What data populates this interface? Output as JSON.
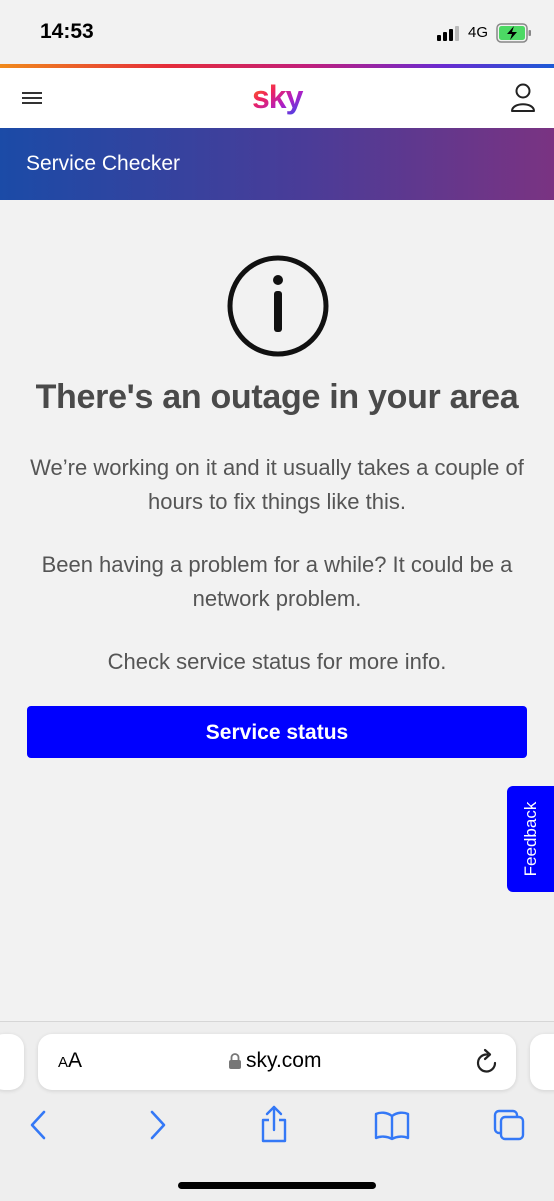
{
  "status_bar": {
    "time": "14:53",
    "network": "4G",
    "icons": [
      "signal-icon",
      "battery-charging-icon"
    ]
  },
  "header": {
    "logo_text": "sky",
    "icons": [
      "hamburger-menu-icon",
      "account-icon"
    ]
  },
  "banner": {
    "title": "Service Checker"
  },
  "main": {
    "icon": "info-circle-icon",
    "heading": "There's an outage in your area",
    "paragraph_1": "We’re working on it and it usually takes a couple of hours to fix things like this.",
    "paragraph_2": "Been having a problem for a while? It could be a network problem.",
    "paragraph_3": "Check service status for more info.",
    "button_label": "Service status"
  },
  "feedback": {
    "label": "Feedback"
  },
  "browser": {
    "text_size_small": "A",
    "text_size_large": "A",
    "url": "sky.com",
    "icons": [
      "lock-icon",
      "reload-icon",
      "back-icon",
      "forward-icon",
      "share-icon",
      "bookmarks-icon",
      "tabs-icon"
    ]
  },
  "colors": {
    "primary_blue": "#0000ff",
    "background": "#f2f2f2",
    "text": "#4a4a4a"
  }
}
